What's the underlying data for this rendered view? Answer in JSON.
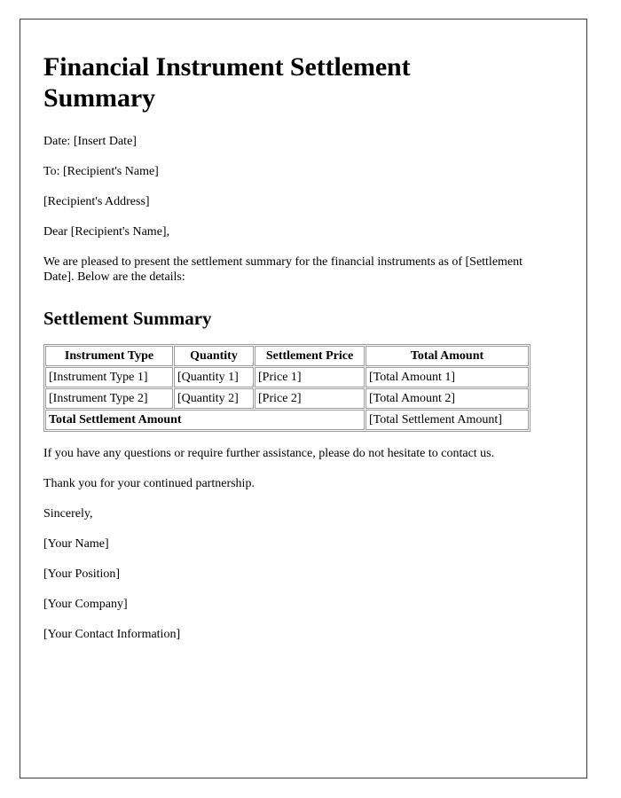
{
  "document": {
    "title": "Financial Instrument Settlement Summary",
    "meta_lines": [
      "Date: [Insert Date]",
      "To: [Recipient's Name]",
      "[Recipient's Address]",
      "Dear [Recipient's Name],"
    ],
    "intro_paragraph": "We are pleased to present the settlement summary for the financial instruments as of [Settlement Date]. Below are the details:",
    "section_heading": "Settlement Summary",
    "table": {
      "headers": [
        "Instrument Type",
        "Quantity",
        "Settlement Price",
        "Total Amount"
      ],
      "rows": [
        [
          "[Instrument Type 1]",
          "[Quantity 1]",
          "[Price 1]",
          "[Total Amount 1]"
        ],
        [
          "[Instrument Type 2]",
          "[Quantity 2]",
          "[Price 2]",
          "[Total Amount 2]"
        ]
      ],
      "total_row": {
        "label": "Total Settlement Amount",
        "value": "[Total Settlement Amount]"
      }
    },
    "closing_lines": [
      "If you have any questions or require further assistance, please do not hesitate to contact us.",
      "Thank you for your continued partnership.",
      "Sincerely,",
      "[Your Name]",
      "[Your Position]",
      "[Your Company]",
      "[Your Contact Information]"
    ]
  },
  "colors": {
    "text": "#000000",
    "page_border": "#3b3b3b",
    "table_border": "#9c9c9c",
    "background": "#ffffff"
  }
}
